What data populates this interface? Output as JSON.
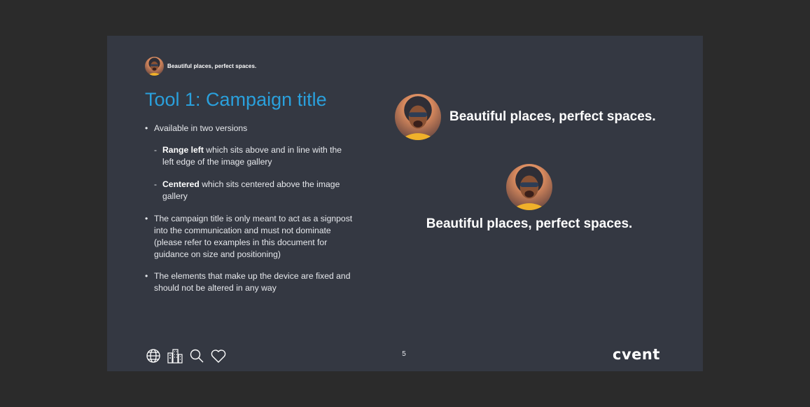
{
  "header": {
    "campaign_title": "Beautiful places, perfect spaces."
  },
  "slide": {
    "title": "Tool 1: Campaign title",
    "page_number": "5"
  },
  "bullets": {
    "b1": "Available in two versions",
    "sub1_bold": "Range left",
    "sub1_text": " which sits above and in line with the left edge of the image gallery",
    "sub2_bold": "Centered",
    "sub2_text": " which sits centered above the image gallery",
    "b2": "The campaign title is only meant to act as a signpost into the communication and must not dominate (please refer to examples in this document for guidance on size and positioning)",
    "b3": "The elements that make up the device are fixed and should not be altered in any way"
  },
  "examples": {
    "range_left_text": "Beautiful places, perfect spaces.",
    "centered_text": "Beautiful places, perfect spaces."
  },
  "footer": {
    "icons": [
      "globe-icon",
      "buildings-icon",
      "search-icon",
      "heart-icon"
    ],
    "logo": "cvent"
  }
}
